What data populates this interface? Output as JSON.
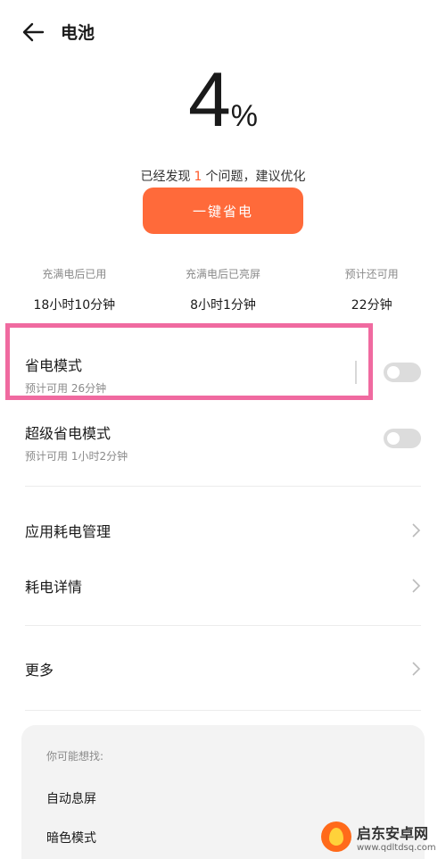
{
  "header": {
    "title": "电池"
  },
  "battery": {
    "level": "4",
    "unit": "%"
  },
  "issue": {
    "prefix": "已经发现",
    "count": "1",
    "suffix": "个问题，建议优化"
  },
  "optimize_button": {
    "label": "一键省电"
  },
  "stats": [
    {
      "label": "充满电后已用",
      "value": "18小时10分钟"
    },
    {
      "label": "充满电后已亮屏",
      "value": "8小时1分钟"
    },
    {
      "label": "预计还可用",
      "value": "22分钟"
    }
  ],
  "power_saving": {
    "title": "省电模式",
    "subtitle": "预计可用 26分钟",
    "enabled": false
  },
  "super_power_saving": {
    "title": "超级省电模式",
    "subtitle": "预计可用 1小时2分钟",
    "enabled": false
  },
  "menu": [
    {
      "label": "应用耗电管理"
    },
    {
      "label": "耗电详情"
    },
    {
      "label": "更多"
    }
  ],
  "suggestions": {
    "heading": "你可能想找:",
    "items": [
      "自动息屏",
      "暗色模式"
    ]
  },
  "watermark": {
    "name": "启东安卓网",
    "url": "www.qdltdsq.com"
  },
  "colors": {
    "accent": "#ff6a3a",
    "highlight": "#f06aa0"
  }
}
